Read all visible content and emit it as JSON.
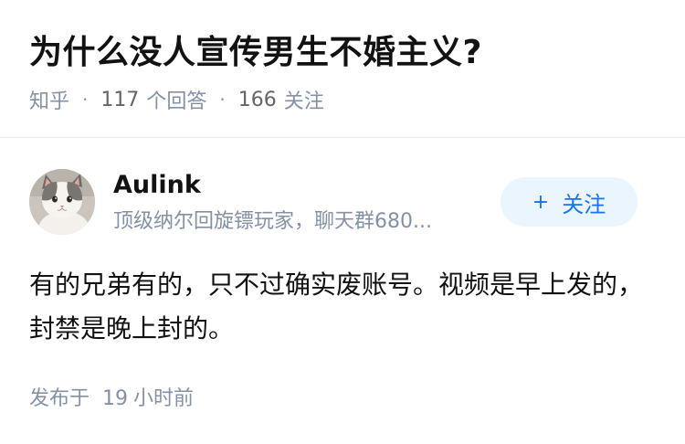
{
  "question": {
    "title": "为什么没人宣传男生不婚主义?",
    "source": "知乎",
    "answers_count": "117",
    "answers_label": "个回答",
    "followers_count": "166",
    "followers_label": "关注",
    "separator": "·"
  },
  "author": {
    "name": "Aulink",
    "bio": "顶级纳尔回旋镖玩家，聊天群680...",
    "avatar_icon": "cat-avatar",
    "follow_button": {
      "plus": "+",
      "label": "关注"
    }
  },
  "answer": {
    "text": "有的兄弟有的，只不过确实废账号。视频是早上发的，封禁是晚上封的。"
  },
  "footer": {
    "prefix": "发布于",
    "time_value": "19",
    "time_unit": "小时前"
  },
  "colors": {
    "accent": "#1772f6",
    "button_bg": "#ebf5fd",
    "meta_gray": "#8590a6",
    "text": "#121212"
  }
}
